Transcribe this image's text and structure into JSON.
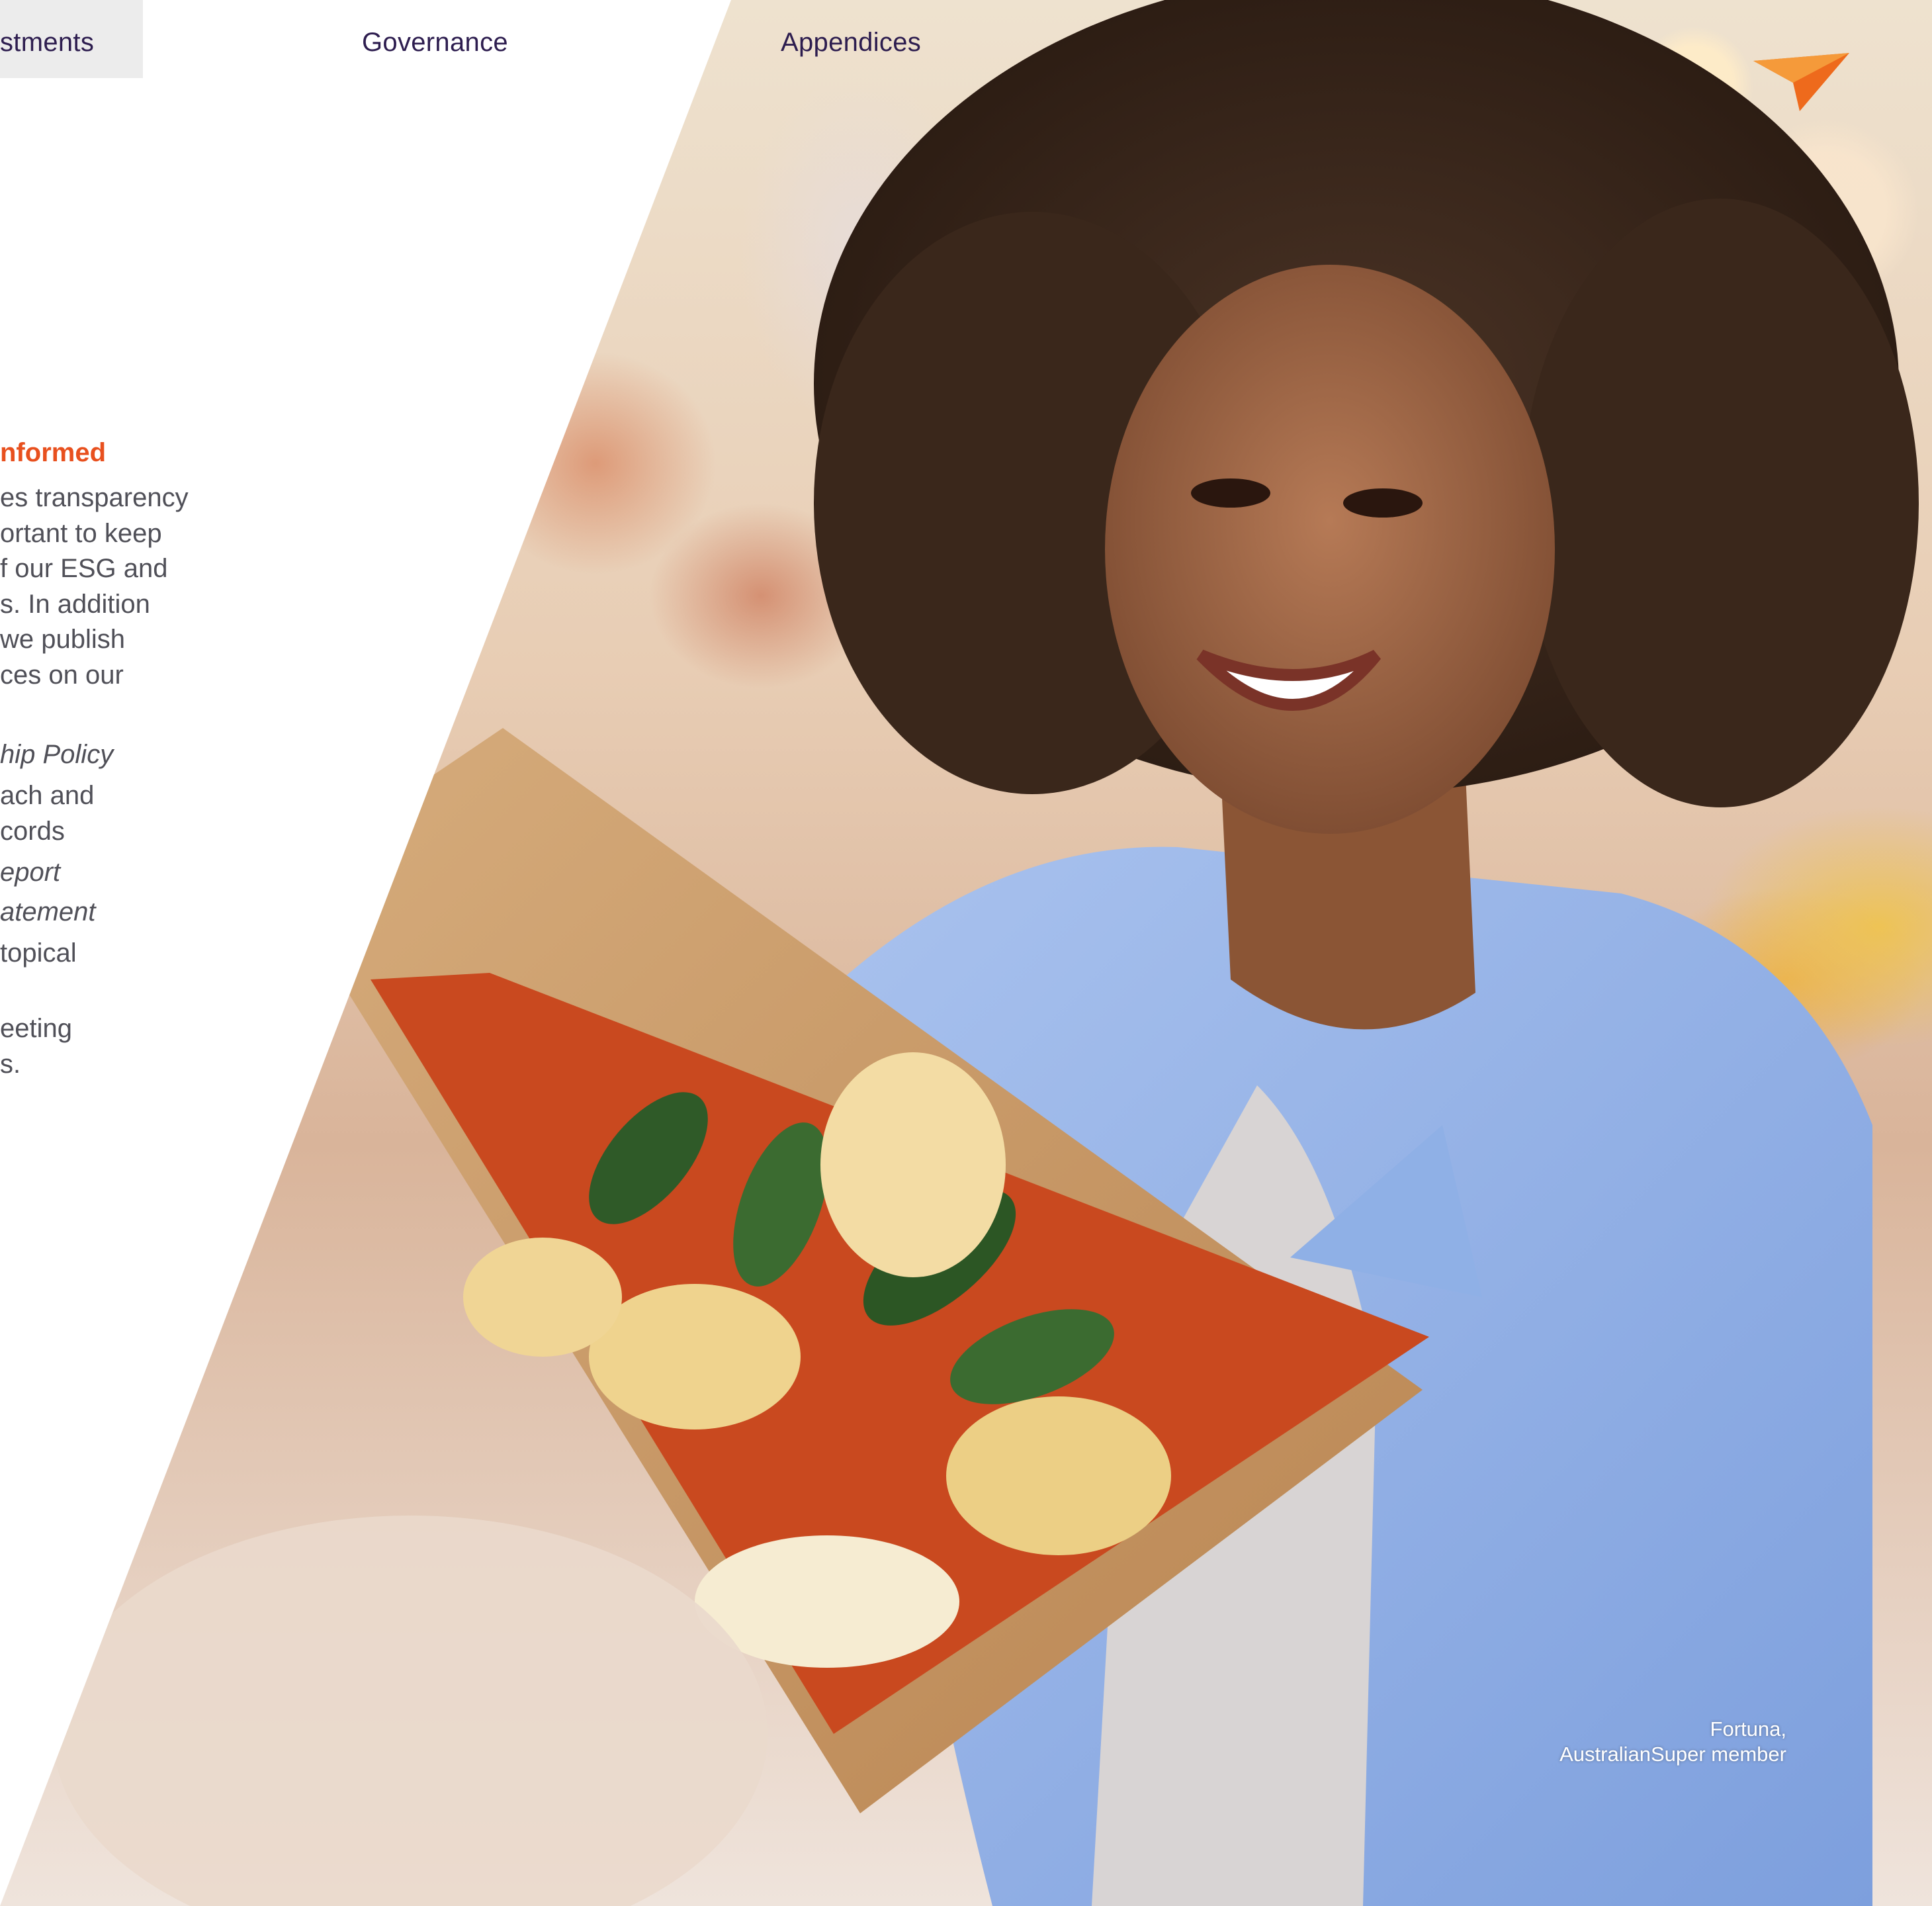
{
  "nav": {
    "items": [
      "stments",
      "Governance",
      "Appendices"
    ],
    "active_index": 0
  },
  "content": {
    "heading": "nformed",
    "lines": [
      "es transparency",
      "ortant to keep",
      "f our ESG and",
      "s. In addition",
      " we publish",
      "ces on our",
      "hip Policy",
      "ach and",
      "cords",
      "eport",
      "atement",
      " topical",
      "eeting",
      "s."
    ]
  },
  "photo": {
    "description_icon": "woman-holding-protea-bouquet-photo",
    "caption_line1": "Fortuna,",
    "caption_line2": "AustralianSuper member"
  },
  "brand": {
    "logo_icon": "paper-plane-logo-icon",
    "accent_color": "#e8501e",
    "nav_text_color": "#2d1d4f"
  }
}
